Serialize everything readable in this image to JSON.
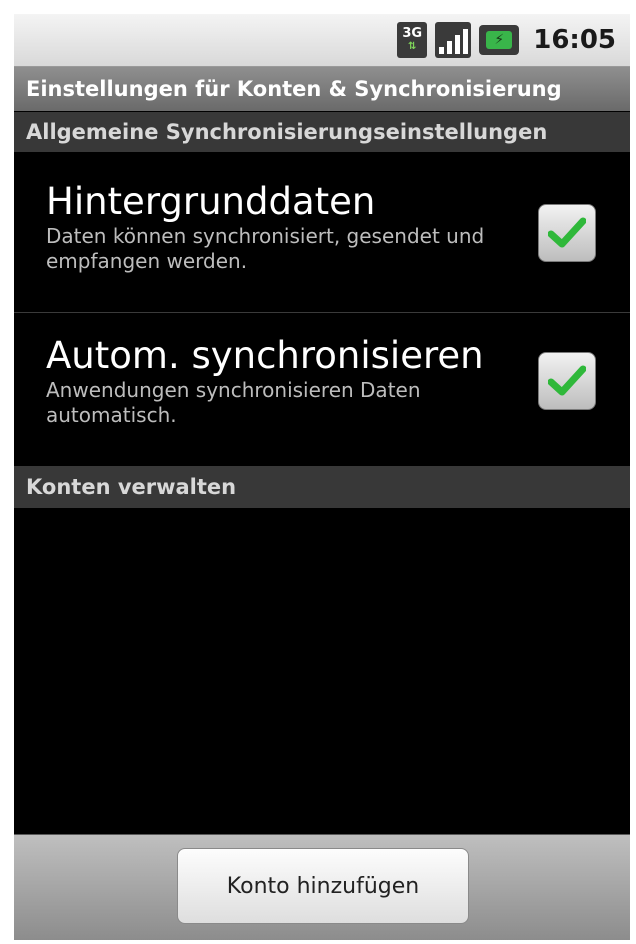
{
  "status_bar": {
    "network_type": "3G",
    "battery_symbol": "⚡",
    "signal_level_of_4": 4,
    "time": "16:05"
  },
  "title_bar": {
    "title": "Einstellungen für Konten & Synchronisierung"
  },
  "sections": {
    "general": {
      "header": "Allgemeine Synchronisierungseinstellungen",
      "items": [
        {
          "title": "Hintergrunddaten",
          "summary": "Daten können synchronisiert, gesendet und empfangen werden.",
          "checked": true
        },
        {
          "title": "Autom. synchronisieren",
          "summary": "Anwendungen synchronisieren Daten automatisch.",
          "checked": true
        }
      ]
    },
    "accounts": {
      "header": "Konten verwalten"
    }
  },
  "bottom_bar": {
    "add_account_label": "Konto hinzufügen"
  },
  "colors": {
    "check_green": "#2fb83a",
    "background": "#000000",
    "section_header_bg": "#383838"
  },
  "icons": {
    "network": "3g-icon",
    "signal": "signal-icon",
    "battery": "battery-charging-icon",
    "checkmark": "checkmark-icon"
  }
}
